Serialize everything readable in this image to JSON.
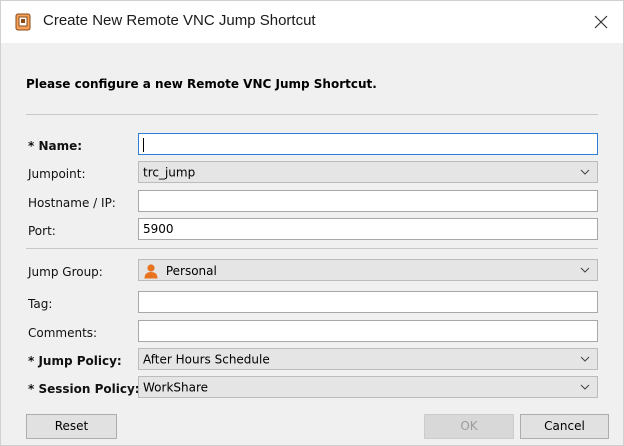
{
  "window": {
    "title": "Create New Remote VNC Jump Shortcut",
    "icons": {
      "app": "vnc-shortcut-icon",
      "close": "close-icon"
    }
  },
  "form": {
    "heading": "Please configure a new Remote VNC Jump Shortcut.",
    "name": {
      "label": "* Name:",
      "value": ""
    },
    "jumpoint": {
      "label": "Jumpoint:",
      "value": "trc_jump"
    },
    "hostname": {
      "label": "Hostname / IP:",
      "value": ""
    },
    "port": {
      "label": "Port:",
      "value": "5900"
    },
    "jump_group": {
      "label": "Jump Group:",
      "value": "Personal",
      "icon": "person-icon"
    },
    "tag": {
      "label": "Tag:",
      "value": ""
    },
    "comments": {
      "label": "Comments:",
      "value": ""
    },
    "jump_policy": {
      "label": "* Jump Policy:",
      "value": "After Hours Schedule"
    },
    "session_policy": {
      "label": "* Session Policy:",
      "value": "WorkShare"
    }
  },
  "buttons": {
    "reset": "Reset",
    "ok": "OK",
    "cancel": "Cancel"
  },
  "colors": {
    "focus_border": "#2d7fd6",
    "panel_background": "#f0f0f0",
    "disabled_text": "#9c9c9c",
    "person_icon": "#e8731e"
  }
}
